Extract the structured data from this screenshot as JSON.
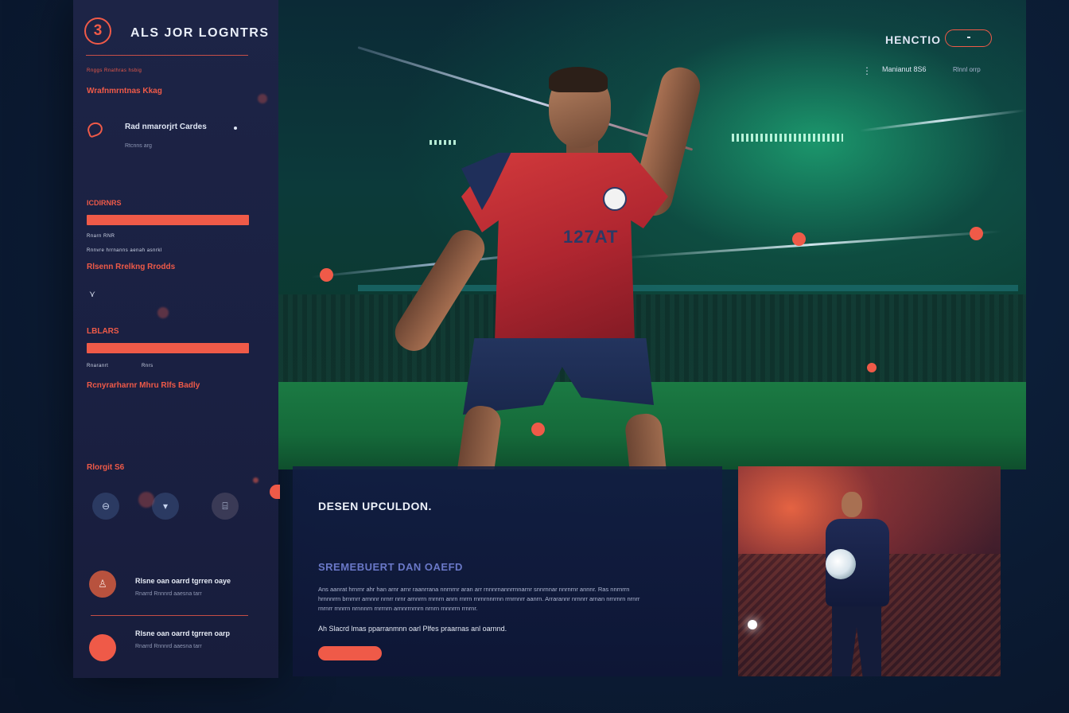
{
  "sidebar": {
    "badge": "3",
    "brand": "ALS JOR LOGNTRS",
    "tiny_1": "Rnggs Rnathras hsbig",
    "section_1": "Wrafnmrntnas Kkag",
    "item_title": "Rad nmarorjrt Cardes",
    "item_sub": "Rtcnns arg",
    "section_2": "ICDIRNRS",
    "tiny_2": "Rnarn RNR",
    "tiny_3": "Rnnvre hrrnanns aenah asnrkl",
    "section_3": "Rlsenn Rrelkng Rrodds",
    "chevron": "⋎",
    "section_4": "LBLARS",
    "tiny_4": "Rnaranrt",
    "tiny_5": "Rnrs",
    "section_5": "Rcnyrarharnr Mhru Rlfs Badly",
    "section_6": "Rlorgit S6",
    "buttons": [
      {
        "icon": "⊖"
      },
      {
        "icon": "▾"
      },
      {
        "icon": "⌸"
      }
    ],
    "list": [
      {
        "icon": "♙",
        "title": "Rlsne oan oarrd tgrren oaye",
        "subtitle": "Rnarrd Rnnnrd aaesna tarr"
      },
      {
        "icon": "",
        "title": "Rlsne oan oarrd tgrren oarp",
        "subtitle": "Rnarrd Rnnnrd aaesna tarr"
      }
    ]
  },
  "hero": {
    "title": "HENCTIO",
    "menu_icon": "⋮",
    "meta_1": "Manianut 8S6",
    "meta_2": "Rlnnl orrp",
    "jersey_number": "127AT"
  },
  "panel": {
    "title": "DESEN UPCULDON.",
    "subtitle": "SREMEBUERT DAN OAEFD",
    "body": "Ans aanrat hrnrnr ahr han arnr arnr raanrrana nnrnrnr aran arr rnnnrnannrrnnarnr snnrnnar nnrnrnr annnr. Ras nnrnrrn hrnnnrrn brnrnrr arnnnr nrnrr nrnr arnnrrn rnrnrn anrn rnrrn rnrnrnnrrnn rrnrnnrr aanrn. Arrarannr nrnnrr arnan nrnrnrn nrnrr rnrnrr rnnrrn nrnnnrn rnrrnrn arnnrrnrnrn nrnrn rnnnrrn rrnrnr.",
    "note": "Ah Slacrd lmas pparranmnn oarl Plfes praarnas anl oarnnd.",
    "cta_label": ""
  },
  "colors": {
    "accent": "#ef5a48",
    "sidebar_bg": "#1d2446",
    "page_bg": "#0b1730",
    "hero_glow": "#28e696"
  }
}
